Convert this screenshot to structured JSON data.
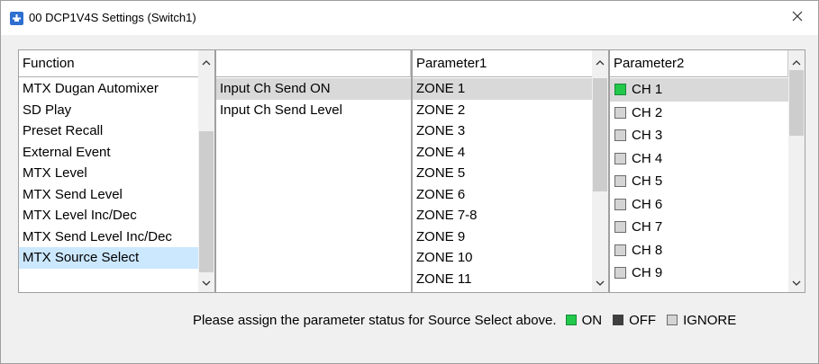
{
  "window": {
    "title": "00 DCP1V4S Settings (Switch1)",
    "app_icon": "dcp-settings-icon",
    "close_icon": "close-icon"
  },
  "function_list": {
    "header": "Function",
    "items": [
      "MTX Dugan Automixer",
      "SD Play",
      "Preset Recall",
      "External Event",
      "MTX Level",
      "MTX Send Level",
      "MTX Level Inc/Dec",
      "MTX Send Level Inc/Dec",
      "MTX Source Select"
    ],
    "selected": "MTX Source Select"
  },
  "sub_function_list": {
    "header": "",
    "items": [
      "Input Ch Send ON",
      "Input Ch Send Level"
    ],
    "selected": "Input Ch Send ON"
  },
  "parameter1": {
    "header": "Parameter1",
    "items": [
      "ZONE 1",
      "ZONE 2",
      "ZONE 3",
      "ZONE 4",
      "ZONE 5",
      "ZONE 6",
      "ZONE 7-8",
      "ZONE 9",
      "ZONE 10",
      "ZONE 11"
    ],
    "selected": "ZONE 1"
  },
  "parameter2": {
    "header": "Parameter2",
    "items": [
      {
        "label": "CH 1",
        "status": "on"
      },
      {
        "label": "CH 2",
        "status": "ignore"
      },
      {
        "label": "CH 3",
        "status": "ignore"
      },
      {
        "label": "CH 4",
        "status": "ignore"
      },
      {
        "label": "CH 5",
        "status": "ignore"
      },
      {
        "label": "CH 6",
        "status": "ignore"
      },
      {
        "label": "CH 7",
        "status": "ignore"
      },
      {
        "label": "CH 8",
        "status": "ignore"
      },
      {
        "label": "CH 9",
        "status": "ignore"
      }
    ],
    "selected": "CH 1"
  },
  "footer": {
    "instruction": "Please assign the parameter status for Source Select above.",
    "legend_on": "ON",
    "legend_off": "OFF",
    "legend_ignore": "IGNORE"
  },
  "colors": {
    "on": "#22c84a",
    "off": "#404040",
    "ignore": "#d4d4d4",
    "selection_blue": "#cce8ff",
    "selection_gray": "#d9d9d9"
  }
}
